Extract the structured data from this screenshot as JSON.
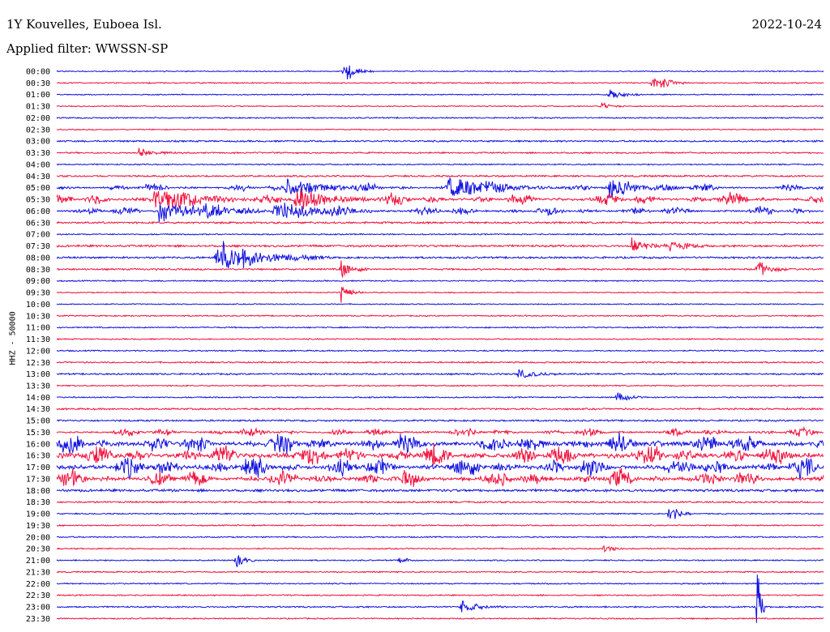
{
  "header": {
    "station": "1Y Kouvelles, Euboea Isl.",
    "date": "2022-10-24",
    "filter": "Applied filter: WWSSN-SP"
  },
  "chart_data": {
    "type": "line",
    "chart_kind": "helicorder",
    "channel_label": "HHZ - 50000",
    "trace_colors": [
      "#1010e0",
      "#f0103c"
    ],
    "grid": false,
    "rows": [
      "00:00",
      "00:30",
      "01:00",
      "01:30",
      "02:00",
      "02:30",
      "03:00",
      "03:30",
      "04:00",
      "04:30",
      "05:00",
      "05:30",
      "06:00",
      "06:30",
      "07:00",
      "07:30",
      "08:00",
      "08:30",
      "09:00",
      "09:30",
      "10:00",
      "10:30",
      "11:00",
      "11:30",
      "12:00",
      "12:30",
      "13:00",
      "13:30",
      "14:00",
      "14:30",
      "15:00",
      "15:30",
      "16:00",
      "16:30",
      "17:00",
      "17:30",
      "18:00",
      "18:30",
      "19:00",
      "19:30",
      "20:00",
      "20:30",
      "21:00",
      "21:30",
      "22:00",
      "22:30",
      "23:00",
      "23:30"
    ],
    "y_tick_labels": [
      "00:00",
      "00:30",
      "01:00",
      "01:30",
      "02:00",
      "02:30",
      "03:00",
      "03:30",
      "04:00",
      "04:30",
      "05:00",
      "05:30",
      "06:00",
      "06:30",
      "07:00",
      "07:30",
      "08:00",
      "08:30",
      "09:00",
      "09:30",
      "10:00",
      "10:30",
      "11:00",
      "11:30",
      "12:00",
      "12:30",
      "13:00",
      "13:30",
      "14:00",
      "14:30",
      "15:00",
      "15:30",
      "16:00",
      "16:30",
      "17:00",
      "17:30",
      "18:00",
      "18:30",
      "19:00",
      "19:30",
      "20:00",
      "20:30",
      "21:00",
      "21:30",
      "22:00",
      "22:30",
      "23:00",
      "23:30"
    ],
    "row_activity": [
      0.5,
      0.6,
      0.5,
      0.5,
      0.6,
      0.5,
      0.8,
      0.7,
      0.6,
      0.8,
      1.4,
      2.2,
      1.6,
      0.9,
      0.6,
      1.0,
      0.9,
      0.8,
      0.6,
      0.5,
      0.5,
      0.6,
      0.6,
      0.6,
      0.6,
      0.7,
      0.8,
      0.6,
      0.6,
      0.8,
      0.8,
      1.5,
      3.6,
      3.8,
      3.6,
      3.0,
      1.2,
      0.8,
      0.6,
      0.6,
      0.6,
      0.6,
      0.6,
      0.6,
      0.6,
      0.6,
      0.7,
      0.6
    ],
    "events": [
      {
        "row": "00:00",
        "minute": 11.2,
        "amplitude": 16,
        "duration": 0.4
      },
      {
        "row": "00:30",
        "minute": 23.3,
        "amplitude": 12,
        "duration": 0.5
      },
      {
        "row": "01:00",
        "minute": 21.6,
        "amplitude": 9,
        "duration": 0.4
      },
      {
        "row": "01:30",
        "minute": 21.3,
        "amplitude": 5,
        "duration": 0.3
      },
      {
        "row": "03:30",
        "minute": 3.2,
        "amplitude": 5,
        "duration": 0.5
      },
      {
        "row": "05:00",
        "minute": 9.0,
        "amplitude": 14,
        "duration": 1.2
      },
      {
        "row": "05:00",
        "minute": 15.3,
        "amplitude": 14,
        "duration": 1.5
      },
      {
        "row": "05:00",
        "minute": 21.6,
        "amplitude": 14,
        "duration": 1.0
      },
      {
        "row": "05:30",
        "minute": 3.8,
        "amplitude": 12,
        "duration": 1.5
      },
      {
        "row": "05:30",
        "minute": 9.3,
        "amplitude": 12,
        "duration": 1.2
      },
      {
        "row": "06:00",
        "minute": 4.0,
        "amplitude": 14,
        "duration": 1.5
      },
      {
        "row": "06:00",
        "minute": 8.5,
        "amplitude": 14,
        "duration": 1.3
      },
      {
        "row": "07:30",
        "minute": 22.5,
        "amplitude": 10,
        "duration": 0.5
      },
      {
        "row": "07:30",
        "minute": 24.0,
        "amplitude": 8,
        "duration": 0.5
      },
      {
        "row": "08:00",
        "minute": 6.2,
        "amplitude": 22,
        "duration": 1.5
      },
      {
        "row": "08:30",
        "minute": 11.1,
        "amplitude": 12,
        "duration": 0.4
      },
      {
        "row": "08:30",
        "minute": 27.4,
        "amplitude": 12,
        "duration": 0.4
      },
      {
        "row": "09:30",
        "minute": 11.1,
        "amplitude": 14,
        "duration": 0.3
      },
      {
        "row": "13:00",
        "minute": 18.0,
        "amplitude": 6,
        "duration": 0.6
      },
      {
        "row": "14:00",
        "minute": 21.9,
        "amplitude": 6,
        "duration": 0.4
      },
      {
        "row": "19:00",
        "minute": 23.9,
        "amplitude": 16,
        "duration": 0.3
      },
      {
        "row": "20:30",
        "minute": 21.4,
        "amplitude": 6,
        "duration": 0.3
      },
      {
        "row": "21:00",
        "minute": 7.0,
        "amplitude": 9,
        "duration": 0.3
      },
      {
        "row": "21:00",
        "minute": 13.4,
        "amplitude": 5,
        "duration": 0.3
      },
      {
        "row": "23:00",
        "minute": 15.8,
        "amplitude": 8,
        "duration": 0.6
      },
      {
        "row": "23:00",
        "minute": 27.4,
        "amplitude": 90,
        "duration": 0.1
      }
    ],
    "title": "1Y Kouvelles, Euboea Isl.",
    "xlabel": "",
    "ylabel": "HHZ - 50000"
  }
}
